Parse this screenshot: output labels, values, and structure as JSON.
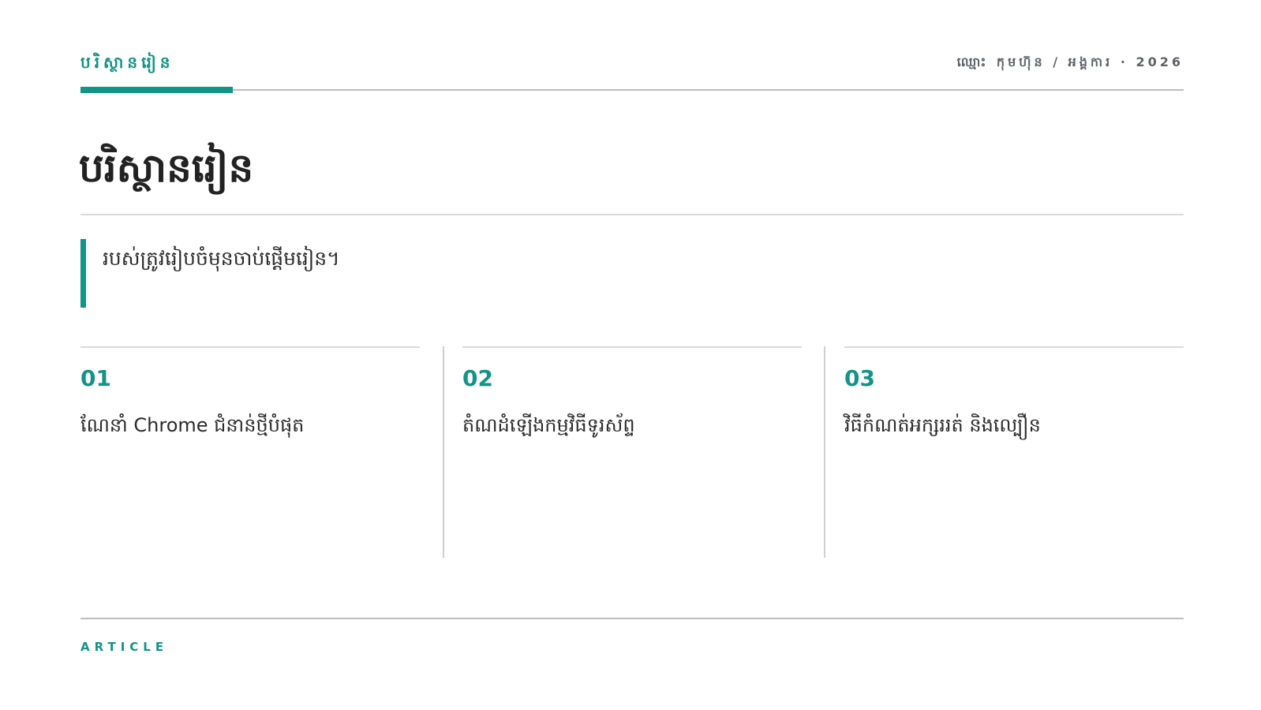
{
  "header": {
    "kicker": "បរិស្ថានរៀន",
    "meta": "ឈ្មោះ កុមហ៊ុន / អង្គការ · 2026"
  },
  "page": {
    "title": "បរិស្ថានរៀន",
    "callout": "របស់ត្រូវរៀបចំមុនចាប់ផ្តើមរៀន។"
  },
  "items": [
    {
      "number": "01",
      "text": "ណែនាំ Chrome ជំនាន់ថ្មីបំផុត"
    },
    {
      "number": "02",
      "text": "តំណដំឡើងកម្មវិធីទូរស័ព្ទ"
    },
    {
      "number": "03",
      "text": "វិធីកំណត់អក្សររត់ និងល្បឿន"
    }
  ],
  "footer": {
    "label": "ARTICLE"
  },
  "colors": {
    "accent": "#129486",
    "text": "#2b2b2b",
    "muted": "#5f6368",
    "rule": "#d9d9d9"
  }
}
